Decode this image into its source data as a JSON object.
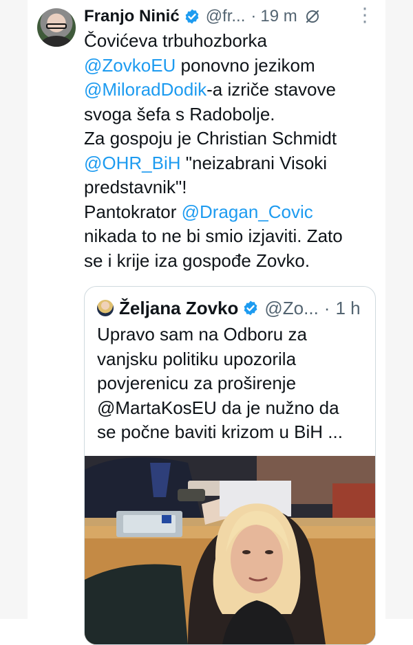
{
  "tweet": {
    "author_name": "Franjo Ninić",
    "author_handle": "@fr...",
    "separator": "·",
    "time": "19 m",
    "more_icon": "more-icon",
    "body_lines": [
      {
        "parts": [
          {
            "t": "Čovićeva trbuhozborka",
            "m": false
          }
        ]
      },
      {
        "parts": [
          {
            "t": "@ZovkoEU",
            "m": true
          },
          {
            "t": " ponovno jezikom",
            "m": false
          }
        ]
      },
      {
        "parts": [
          {
            "t": "@MiloradDodik",
            "m": true
          },
          {
            "t": "-a izriče stavove",
            "m": false
          }
        ]
      },
      {
        "parts": [
          {
            "t": "svoga šefa s Radobolje.",
            "m": false
          }
        ]
      },
      {
        "parts": [
          {
            "t": "Za gospoju je Christian Schmidt",
            "m": false
          }
        ]
      },
      {
        "parts": [
          {
            "t": "@OHR_BiH",
            "m": true
          },
          {
            "t": " \"neizabrani Visoki",
            "m": false
          }
        ]
      },
      {
        "parts": [
          {
            "t": "predstavnik\"!",
            "m": false
          }
        ]
      },
      {
        "parts": [
          {
            "t": "Pantokrator ",
            "m": false
          },
          {
            "t": "@Dragan_Covic",
            "m": true
          }
        ]
      },
      {
        "parts": [
          {
            "t": "nikada to ne bi smio izjaviti. Zato",
            "m": false
          }
        ]
      },
      {
        "parts": [
          {
            "t": "se i krije iza gospođe Zovko.",
            "m": false
          }
        ]
      }
    ]
  },
  "quote": {
    "author_name": "Željana Zovko",
    "author_handle": "@Zo...",
    "separator": "·",
    "time": "1 h",
    "text_lines": [
      "Upravo sam na Odboru za",
      "vanjsku politiku upozorila",
      "povjerenicu za proširenje",
      "@MartaKosEU da je nužno da",
      "se počne baviti krizom u BiH ..."
    ]
  },
  "colors": {
    "link": "#1d9bf0",
    "text": "#0f1419",
    "muted": "#536471",
    "border": "#cfd9de",
    "verified": "#1d9bf0"
  }
}
